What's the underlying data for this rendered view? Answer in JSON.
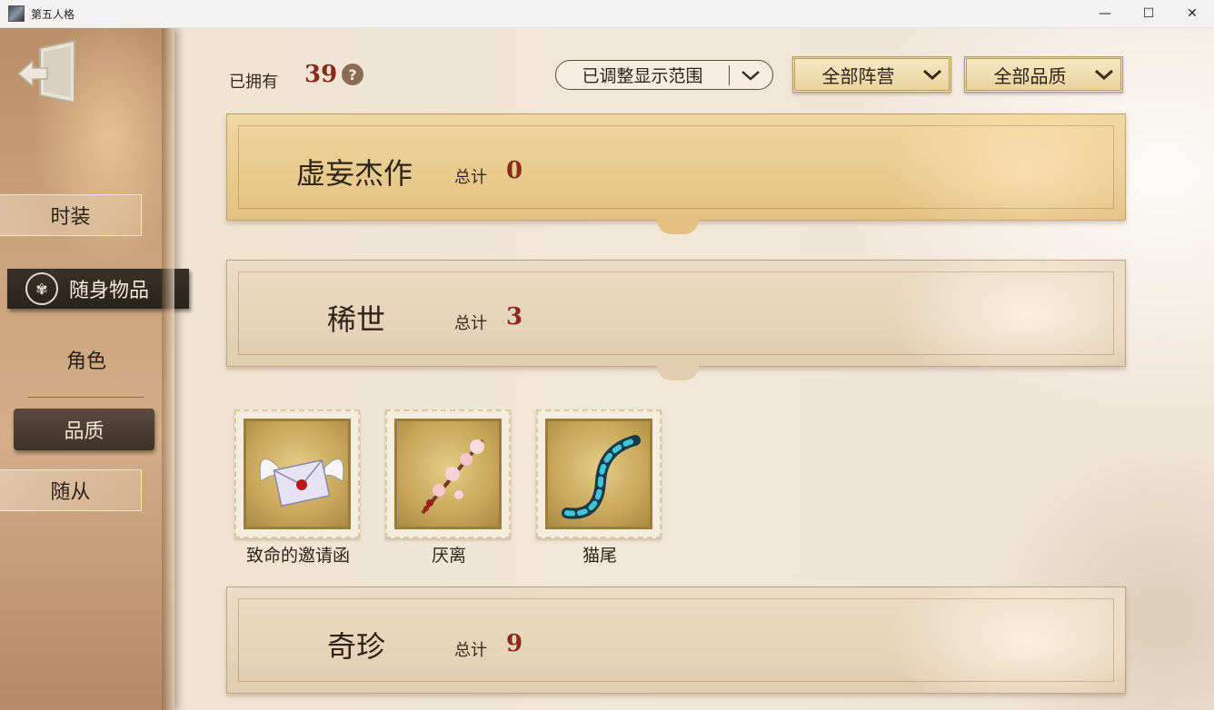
{
  "window": {
    "title": "第五人格",
    "min_glyph": "—",
    "max_glyph": "☐",
    "close_glyph": "✕"
  },
  "sidebar": {
    "back_icon": "exit-door-icon",
    "tabs": {
      "costume": "时装",
      "accessories": "随身物品"
    },
    "sub_tabs": {
      "character": "角色",
      "quality": "品质",
      "follower": "随从"
    }
  },
  "topbar": {
    "owned_label": "已拥有",
    "owned_count": "39",
    "help_glyph": "?",
    "range_button": "已调整显示范围",
    "faction_filter": "全部阵营",
    "quality_filter": "全部品质"
  },
  "categories": [
    {
      "name": "虚妄杰作",
      "total_label": "总计",
      "total": "0"
    },
    {
      "name": "稀世",
      "total_label": "总计",
      "total": "3"
    },
    {
      "name": "奇珍",
      "total_label": "总计",
      "total": "9"
    }
  ],
  "items": [
    {
      "name": "致命的邀请函",
      "icon": "winged-letter-icon"
    },
    {
      "name": "厌离",
      "icon": "blossom-branch-icon"
    },
    {
      "name": "猫尾",
      "icon": "cat-tail-icon"
    }
  ],
  "colors": {
    "accent_red": "#8a2a1a",
    "gold_banner": "#e4c183",
    "dark_tab": "#2a231c"
  }
}
